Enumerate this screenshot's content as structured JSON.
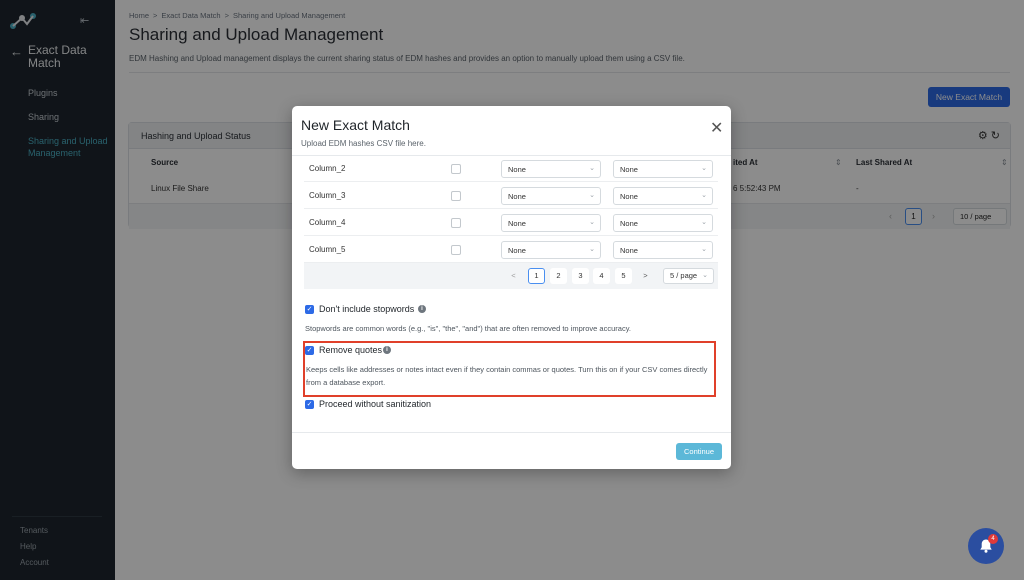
{
  "sidebar": {
    "back_title": "Exact Data Match",
    "items": [
      {
        "label": "Plugins"
      },
      {
        "label": "Sharing"
      },
      {
        "label": "Sharing and Upload Management"
      }
    ],
    "footer": [
      {
        "label": "Tenants"
      },
      {
        "label": "Help"
      },
      {
        "label": "Account"
      }
    ]
  },
  "breadcrumb": [
    "Home",
    "Exact Data Match",
    "Sharing and Upload Management"
  ],
  "breadcrumb_sep": ">",
  "page": {
    "title": "Sharing and Upload Management",
    "description": "EDM Hashing and Upload management displays the current sharing status of EDM hashes and provides an option to manually upload them using a CSV file.",
    "new_button": "New Exact Match"
  },
  "card": {
    "title": "Hashing and Upload Status",
    "headers": [
      "Source",
      "ited At",
      "Last Shared At"
    ],
    "row": [
      "Linux File Share",
      "6 5:52:43 PM",
      "-"
    ],
    "page": "1",
    "per_page": "10 / page"
  },
  "modal": {
    "title": "New Exact Match",
    "subtitle": "Upload EDM hashes CSV file here.",
    "columns": [
      {
        "name": "Column_2",
        "sel1": "None",
        "sel2": "None"
      },
      {
        "name": "Column_3",
        "sel1": "None",
        "sel2": "None"
      },
      {
        "name": "Column_4",
        "sel1": "None",
        "sel2": "None"
      },
      {
        "name": "Column_5",
        "sel1": "None",
        "sel2": "None"
      }
    ],
    "pager": {
      "pages": [
        "1",
        "2",
        "3",
        "4",
        "5"
      ],
      "prev": "<",
      "next": ">",
      "per_page": "5 / page"
    },
    "options": {
      "stopwords_label": "Don't include stopwords",
      "stopwords_desc": "Stopwords are common words (e.g., \"is\", \"the\", \"and\") that are often removed to improve accuracy.",
      "quotes_label": "Remove quotes",
      "quotes_desc": "Keeps cells like addresses or notes intact even if they contain commas or quotes. Turn this on if your CSV comes directly from a database export.",
      "sanitize_label": "Proceed without sanitization"
    },
    "continue": "Continue"
  },
  "notifications": {
    "count": "4"
  },
  "colors": {
    "accent": "#2d6ae6",
    "sidebar": "#1e262e",
    "active_nav": "#4bb1c6",
    "highlight": "#e0402a",
    "continue": "#5cb8d8"
  }
}
